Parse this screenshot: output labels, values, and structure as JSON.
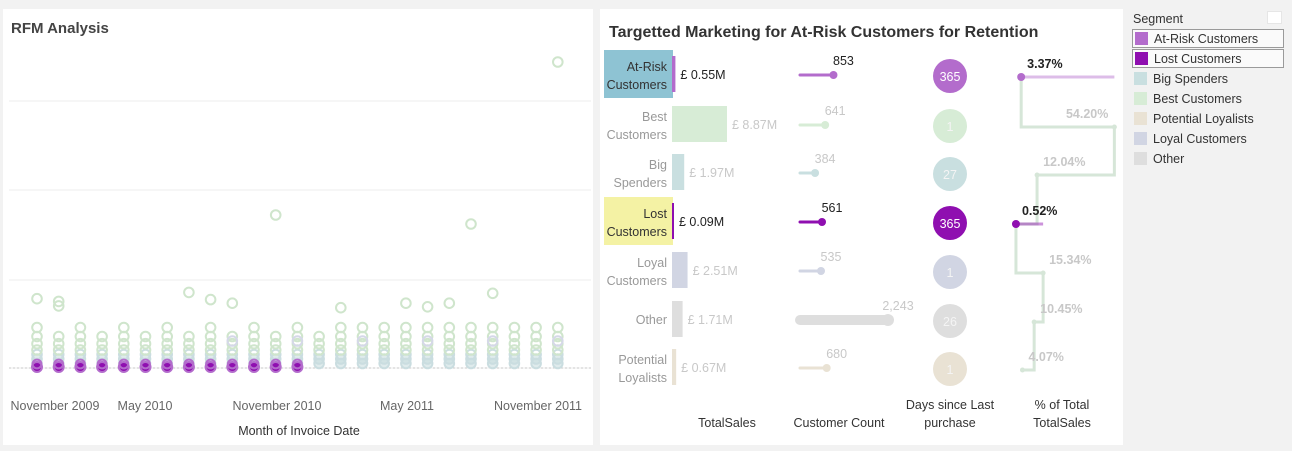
{
  "rfm": {
    "title": "RFM Analysis",
    "x_axis_title": "Month of Invoice Date",
    "x_ticks": [
      "November 2009",
      "May 2010",
      "November 2010",
      "May 2011",
      "November 2011"
    ]
  },
  "targeted": {
    "title": "Targetted Marketing for At-Risk Customers for Retention",
    "columns": [
      "TotalSales",
      "Customer Count",
      "Days since Last purchase",
      "% of Total TotalSales"
    ]
  },
  "legend": {
    "title": "Segment",
    "items": [
      {
        "label": "At-Risk Customers",
        "color": "#b36ccc",
        "selected": true
      },
      {
        "label": "Lost Customers",
        "color": "#8f0fb0",
        "selected": true
      },
      {
        "label": "Big Spenders",
        "color": "#c9dfe0",
        "selected": false
      },
      {
        "label": "Best Customers",
        "color": "#d7ecd6",
        "selected": false
      },
      {
        "label": "Potential Loyalists",
        "color": "#e9e2d4",
        "selected": false
      },
      {
        "label": "Loyal Customers",
        "color": "#d1d5e3",
        "selected": false
      },
      {
        "label": "Other",
        "color": "#dedede",
        "selected": false
      }
    ]
  },
  "chart_data": [
    {
      "type": "scatter",
      "title": "RFM Analysis",
      "xlabel": "Month of Invoice Date",
      "x_tick_labels": [
        "November 2009",
        "May 2010",
        "November 2010",
        "May 2011",
        "November 2011"
      ],
      "months": [
        "Dec 2009",
        "Jan 2010",
        "Feb 2010",
        "Mar 2010",
        "Apr 2010",
        "May 2010",
        "Jun 2010",
        "Jul 2010",
        "Aug 2010",
        "Sep 2010",
        "Oct 2010",
        "Nov 2010",
        "Dec 2010",
        "Jan 2011",
        "Feb 2011",
        "Mar 2011",
        "Apr 2011",
        "May 2011",
        "Jun 2011",
        "Jul 2011",
        "Aug 2011",
        "Sep 2011",
        "Oct 2011",
        "Nov 2011",
        "Dec 2011"
      ],
      "highlighted_segments": [
        "At-Risk Customers",
        "Lost Customers"
      ],
      "grid": true,
      "outliers": [
        {
          "month": "Dec 2009",
          "level": 0.77
        },
        {
          "month": "Jan 2010",
          "level": 0.74
        },
        {
          "month": "Jan 2010",
          "level": 0.69
        },
        {
          "month": "Jul 2010",
          "level": 0.84
        },
        {
          "month": "Aug 2010",
          "level": 0.76
        },
        {
          "month": "Sep 2010",
          "level": 0.72
        },
        {
          "month": "Nov 2010",
          "level": 1.7
        },
        {
          "month": "Feb 2011",
          "level": 0.67
        },
        {
          "month": "May 2011",
          "level": 0.72
        },
        {
          "month": "Jun 2011",
          "level": 0.68
        },
        {
          "month": "Jul 2011",
          "level": 0.72
        },
        {
          "month": "Aug 2011",
          "level": 1.6
        },
        {
          "month": "Sep 2011",
          "level": 0.83
        },
        {
          "month": "Dec 2011",
          "level": 3.4
        }
      ]
    },
    {
      "type": "bar",
      "title": "Targetted Marketing for At-Risk Customers for Retention",
      "categories": [
        "At-Risk Customers",
        "Best Customers",
        "Big Spenders",
        "Lost Customers",
        "Loyal Customers",
        "Other",
        "Potential Loyalists"
      ],
      "category_lines": [
        [
          "At-Risk",
          "Customers"
        ],
        [
          "Best",
          "Customers"
        ],
        [
          "Big",
          "Spenders"
        ],
        [
          "Lost",
          "Customers"
        ],
        [
          "Loyal",
          "Customers"
        ],
        [
          "Other"
        ],
        [
          "Potential",
          "Loyalists"
        ]
      ],
      "highlighted": [
        true,
        false,
        false,
        true,
        false,
        false,
        false
      ],
      "label_fill": [
        "#8ec3d3",
        null,
        null,
        "#f4f2a4",
        null,
        null,
        null
      ],
      "colors": [
        "#b36ccc",
        "#d7ecd6",
        "#c9dfe0",
        "#8f0fb0",
        "#d1d5e3",
        "#dedede",
        "#e9e2d4"
      ],
      "series": [
        {
          "name": "TotalSales",
          "unit": "£M",
          "values": [
            0.55,
            8.87,
            1.97,
            0.09,
            2.51,
            1.71,
            0.67
          ],
          "labels": [
            "£ 0.55M",
            "£ 8.87M",
            "£ 1.97M",
            "£ 0.09M",
            "£ 2.51M",
            "£ 1.71M",
            "£ 0.67M"
          ]
        },
        {
          "name": "Customer Count",
          "values": [
            853,
            641,
            384,
            561,
            535,
            2243,
            680
          ],
          "labels": [
            "853",
            "641",
            "384",
            "561",
            "535",
            "2,243",
            "680"
          ]
        },
        {
          "name": "Days since Last purchase",
          "values": [
            365,
            1,
            27,
            365,
            1,
            26,
            1
          ],
          "labels": [
            "365",
            "1",
            "27",
            "365",
            "1",
            "26",
            "1"
          ]
        },
        {
          "name": "% of Total TotalSales",
          "values": [
            3.37,
            54.2,
            12.04,
            0.52,
            15.34,
            10.45,
            4.07
          ],
          "labels": [
            "3.37%",
            "54.20%",
            "12.04%",
            "0.52%",
            "15.34%",
            "10.45%",
            "4.07%"
          ]
        }
      ]
    }
  ]
}
